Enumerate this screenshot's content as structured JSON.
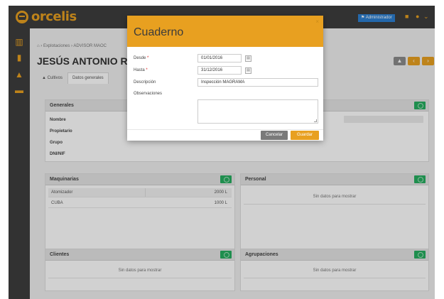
{
  "app": {
    "logo_text": "orcelis"
  },
  "header": {
    "admin_label": "Administrador",
    "icons": [
      "stats-icon",
      "user-icon",
      "chevron-down-icon"
    ]
  },
  "sidebar": {
    "icons": [
      "briefcase-icon",
      "info-icon",
      "flask-icon",
      "folder-icon"
    ]
  },
  "breadcrumb": {
    "home_icon": "home-icon",
    "items": [
      "Explotaciones",
      "ADVISOR MAOC"
    ]
  },
  "page": {
    "title": "JESÚS ANTONIO RODRÍ"
  },
  "nav_buttons": [
    "back-icon",
    "prev-icon",
    "next-icon"
  ],
  "tabs": [
    "Cultivos",
    "Datos generales"
  ],
  "generales": {
    "title": "Generales",
    "fields": [
      "Nombre",
      "Propietario",
      "Grupo",
      "DNI/NIF"
    ]
  },
  "maquinarias": {
    "title": "Maquinarias",
    "rows": [
      {
        "name": "Atomizador",
        "capacity": "2000 L"
      },
      {
        "name": "CUBA",
        "capacity": "1000 L"
      }
    ]
  },
  "personal": {
    "title": "Personal",
    "empty": "Sin datos para mostrar"
  },
  "clientes": {
    "title": "Clientes",
    "empty": "Sin datos para mostrar"
  },
  "agrupaciones": {
    "title": "Agrupaciones",
    "empty": "Sin datos para mostrar"
  },
  "modal": {
    "title": "Cuaderno",
    "close_label": "×",
    "desde_label": "Desde",
    "desde_value": "01/01/2016",
    "hasta_label": "Hasta",
    "hasta_value": "31/12/2016",
    "descripcion_label": "Descripción",
    "descripcion_value": "Inspección MAGRAMA",
    "observaciones_label": "Observaciones",
    "required_mark": "*",
    "cancel_label": "Cancelar",
    "save_label": "Guardar"
  },
  "colors": {
    "accent": "#e8a020",
    "topbar": "#3e3e3e",
    "add_button": "#27ae60",
    "admin_badge": "#2c7fd1",
    "cancel_button": "#7a7a7a",
    "nav_back": "#8c8c8c"
  }
}
